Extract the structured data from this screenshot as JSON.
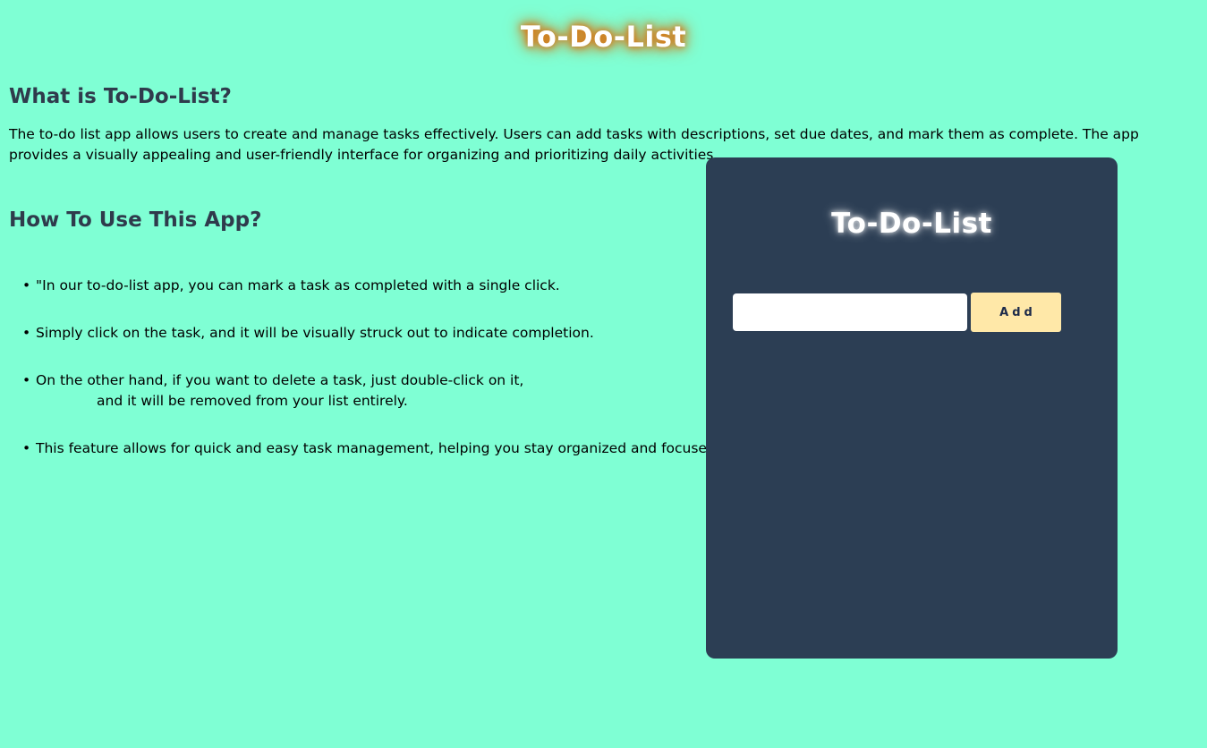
{
  "header": {
    "title": "To-Do-List"
  },
  "about": {
    "heading": "What is To-Do-List?",
    "description": "The to-do list app allows users to create and manage tasks effectively. Users can add tasks with descriptions, set due dates, and mark them as complete. The app provides a visually appealing and user-friendly interface for organizing and prioritizing daily activities."
  },
  "howto": {
    "heading": "How To Use This App?",
    "steps": [
      " \"In our to-do-list app, you can mark a task as completed with a single click.",
      "Simply click on the task, and it will be visually struck out to indicate completion.",
      "On the other hand, if you want to delete a task, just double-click on it,",
      " This feature allows for quick and easy task management, helping you stay organized and focused.\""
    ],
    "step3_continuation": "and it will be removed from your list entirely."
  },
  "app": {
    "title": "To-Do-List",
    "input": {
      "value": "",
      "placeholder": ""
    },
    "add_label": "Add",
    "tasks": []
  },
  "colors": {
    "page_background": "#7fffd4",
    "panel_background": "#2c3e54",
    "heading_text": "#2f3b4c",
    "title_glow": "#e06a00",
    "add_button_background": "#ffe8a8",
    "add_button_text": "#1c2a4a"
  }
}
